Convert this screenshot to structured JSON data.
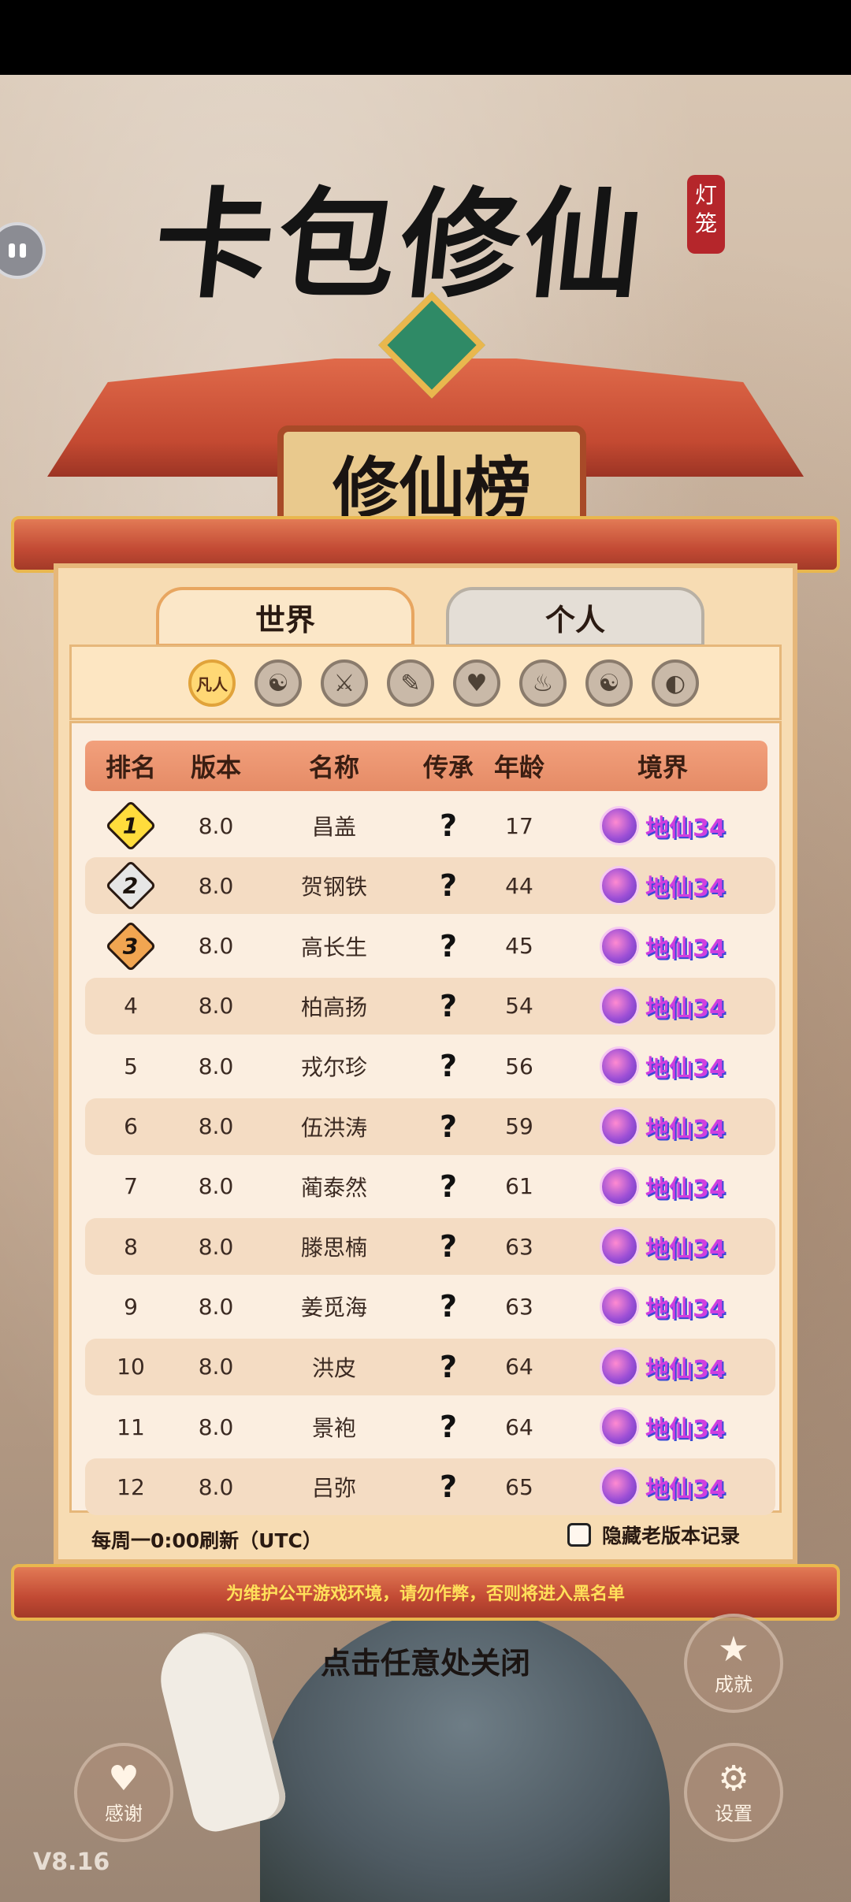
{
  "game_title": "卡包修仙",
  "lantern_seal": "灯笼",
  "board_title": "修仙榜",
  "tabs": [
    {
      "label": "世界",
      "active": true
    },
    {
      "label": "个人",
      "active": false
    }
  ],
  "filters": [
    {
      "label": "凡人",
      "active": true
    },
    {
      "icon": "yin-yang-icon"
    },
    {
      "icon": "sword-icon"
    },
    {
      "icon": "book-icon"
    },
    {
      "icon": "heart-icon"
    },
    {
      "icon": "fire-icon"
    },
    {
      "icon": "yin-yang-icon"
    },
    {
      "icon": "scroll-more-icon"
    }
  ],
  "table": {
    "headers": [
      "排名",
      "版本",
      "名称",
      "传承",
      "年龄",
      "境界"
    ],
    "rows": [
      {
        "rank": "1",
        "version": "8.0",
        "name": "昌盖",
        "inheritance": "?",
        "age": "17",
        "realm": "地仙34"
      },
      {
        "rank": "2",
        "version": "8.0",
        "name": "贺钢铁",
        "inheritance": "?",
        "age": "44",
        "realm": "地仙34"
      },
      {
        "rank": "3",
        "version": "8.0",
        "name": "高长生",
        "inheritance": "?",
        "age": "45",
        "realm": "地仙34"
      },
      {
        "rank": "4",
        "version": "8.0",
        "name": "柏高扬",
        "inheritance": "?",
        "age": "54",
        "realm": "地仙34"
      },
      {
        "rank": "5",
        "version": "8.0",
        "name": "戎尔珍",
        "inheritance": "?",
        "age": "56",
        "realm": "地仙34"
      },
      {
        "rank": "6",
        "version": "8.0",
        "name": "伍洪涛",
        "inheritance": "?",
        "age": "59",
        "realm": "地仙34"
      },
      {
        "rank": "7",
        "version": "8.0",
        "name": "蔺泰然",
        "inheritance": "?",
        "age": "61",
        "realm": "地仙34"
      },
      {
        "rank": "8",
        "version": "8.0",
        "name": "滕思楠",
        "inheritance": "?",
        "age": "63",
        "realm": "地仙34"
      },
      {
        "rank": "9",
        "version": "8.0",
        "name": "姜觅海",
        "inheritance": "?",
        "age": "63",
        "realm": "地仙34"
      },
      {
        "rank": "10",
        "version": "8.0",
        "name": "洪皮",
        "inheritance": "?",
        "age": "64",
        "realm": "地仙34"
      },
      {
        "rank": "11",
        "version": "8.0",
        "name": "景袍",
        "inheritance": "?",
        "age": "64",
        "realm": "地仙34"
      },
      {
        "rank": "12",
        "version": "8.0",
        "name": "吕弥",
        "inheritance": "?",
        "age": "65",
        "realm": "地仙34"
      }
    ]
  },
  "footer": {
    "refresh_note": "每周一0:00刷新（UTC）",
    "hide_old_label": "隐藏老版本记录",
    "hide_old_checked": false
  },
  "warning": "为维护公平游戏环境，请勿作弊，否则将进入黑名单",
  "close_hint": "点击任意处关闭",
  "buttons": {
    "achievements": "成就",
    "thanks": "感谢",
    "settings": "设置"
  },
  "version": "V8.16"
}
